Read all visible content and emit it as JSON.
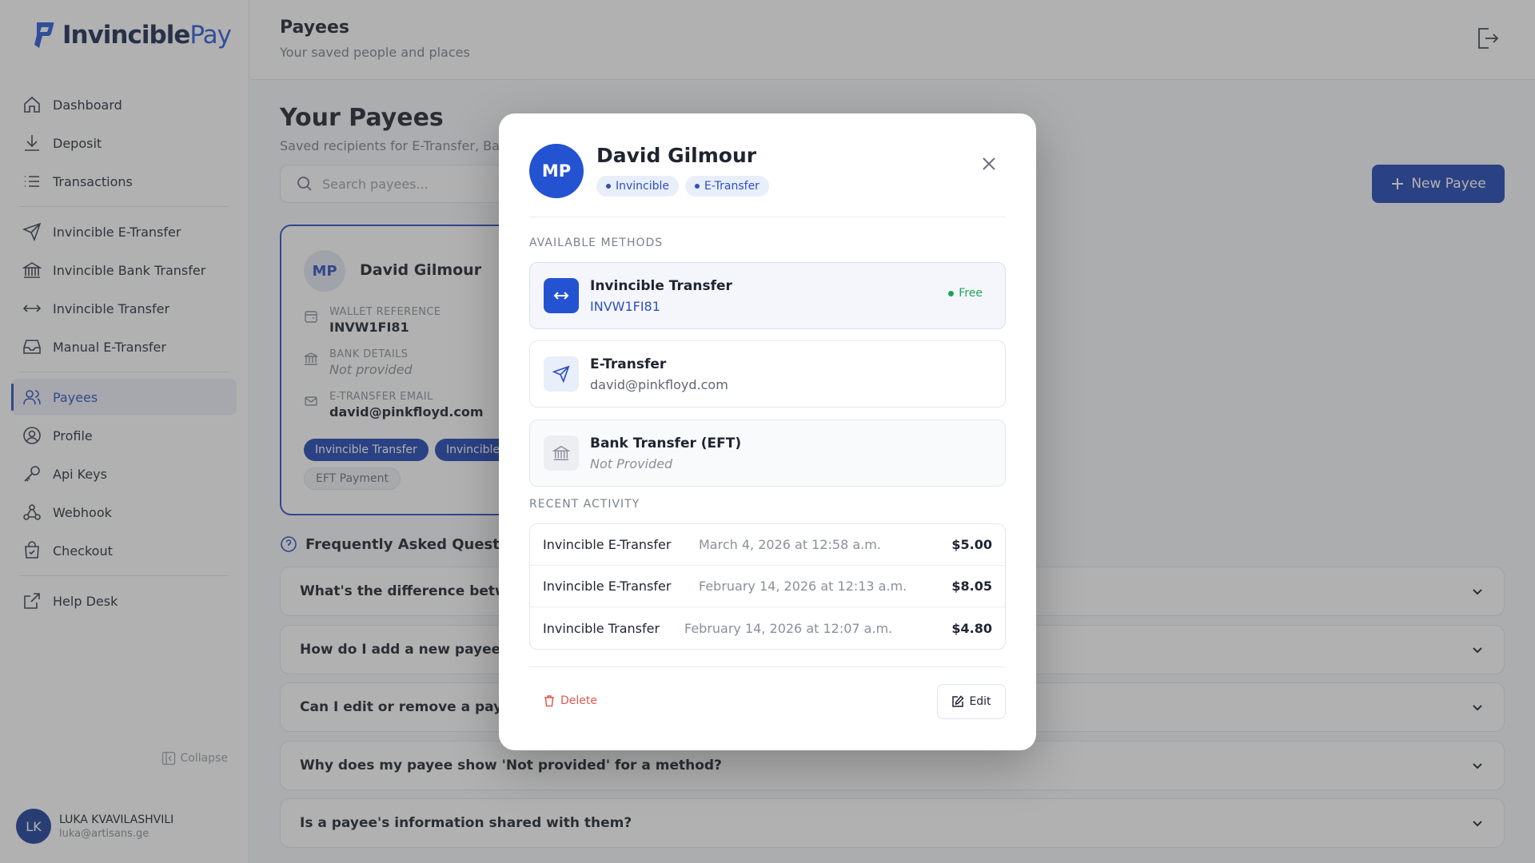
{
  "brand": {
    "name_part1": "Invincible",
    "name_part2": "Pay",
    "color": "#2c5ad8"
  },
  "sidebar": {
    "items": [
      {
        "label": "Dashboard",
        "icon": "home-icon"
      },
      {
        "label": "Deposit",
        "icon": "download-icon"
      },
      {
        "label": "Transactions",
        "icon": "list-icon"
      },
      {
        "label": "Invincible E-Transfer",
        "icon": "send-icon"
      },
      {
        "label": "Invincible Bank Transfer",
        "icon": "bank-icon"
      },
      {
        "label": "Invincible Transfer",
        "icon": "arrows-horizontal-icon"
      },
      {
        "label": "Manual E-Transfer",
        "icon": "inbox-icon"
      },
      {
        "label": "Payees",
        "icon": "users-icon",
        "active": true
      },
      {
        "label": "Profile",
        "icon": "user-circle-icon"
      },
      {
        "label": "Api Keys",
        "icon": "key-icon"
      },
      {
        "label": "Webhook",
        "icon": "webhook-icon"
      },
      {
        "label": "Checkout",
        "icon": "bag-check-icon"
      },
      {
        "label": "Help Desk",
        "icon": "external-link-icon"
      }
    ],
    "collapse_label": "Collapse",
    "user": {
      "initials": "LK",
      "name": "LUKA KVAVILASHVILI",
      "email": "luka@artisans.ge"
    }
  },
  "header": {
    "title": "Payees",
    "subtitle": "Your saved people and places"
  },
  "main": {
    "title": "Your Payees",
    "subtitle": "Saved recipients for E-Transfer, Bar",
    "search_placeholder": "Search payees...",
    "new_payee_label": "New Payee",
    "accent": "#1f45b2"
  },
  "payee_card": {
    "initials": "MP",
    "name": "David Gilmour",
    "wallet_label": "WALLET REFERENCE",
    "wallet_value": "INVW1FI81",
    "bank_label": "BANK DETAILS",
    "bank_value": "Not provided",
    "email_label": "E-TRANSFER EMAIL",
    "email_value": "david@pinkfloyd.com",
    "chips": [
      "Invincible Transfer",
      "Invincible",
      "EFT Payment"
    ]
  },
  "faq": {
    "title": "Frequently Asked Questions",
    "items": [
      "What's the difference between",
      "How do I add a new payee?",
      "Can I edit or remove a payee?",
      "Why does my payee show 'Not provided' for a method?",
      "Is a payee's information shared with them?"
    ]
  },
  "modal": {
    "initials": "MP",
    "name": "David Gilmour",
    "tags": [
      "Invincible",
      "E-Transfer"
    ],
    "methods_heading": "AVAILABLE METHODS",
    "methods": [
      {
        "title": "Invincible Transfer",
        "sub": "INVW1FI81",
        "badge": "Free",
        "icon": "arrows-horizontal-icon"
      },
      {
        "title": "E-Transfer",
        "sub": "david@pinkfloyd.com",
        "icon": "send-icon"
      },
      {
        "title": "Bank Transfer (EFT)",
        "sub": "Not Provided",
        "icon": "bank-icon"
      }
    ],
    "activity_heading": "RECENT ACTIVITY",
    "activity": [
      {
        "type": "Invincible E-Transfer",
        "date": "March 4, 2026 at 12:58 a.m.",
        "amount": "$5.00"
      },
      {
        "type": "Invincible E-Transfer",
        "date": "February 14, 2026 at 12:13 a.m.",
        "amount": "$8.05"
      },
      {
        "type": "Invincible Transfer",
        "date": "February 14, 2026 at 12:07 a.m.",
        "amount": "$4.80"
      }
    ],
    "delete_label": "Delete",
    "edit_label": "Edit",
    "free_color": "#1ea35a",
    "delete_color": "#e0584f"
  }
}
